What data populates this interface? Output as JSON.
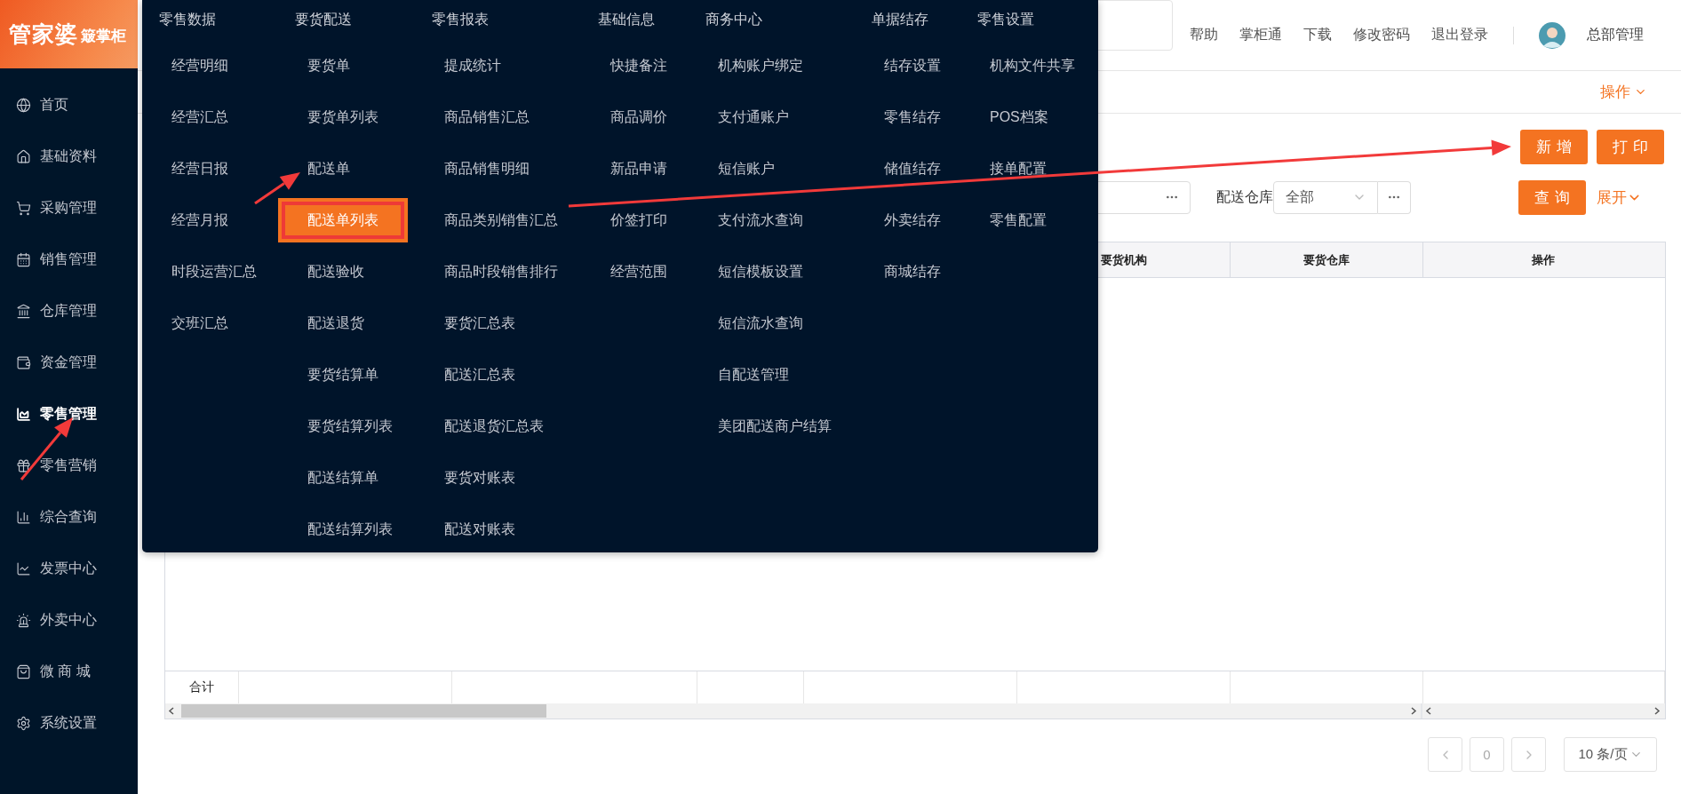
{
  "logo": {
    "brand": "管家婆",
    "product": "簸掌柜"
  },
  "sidebar": {
    "items": [
      {
        "label": "首页",
        "selected": false
      },
      {
        "label": "基础资料",
        "selected": false
      },
      {
        "label": "采购管理",
        "selected": false
      },
      {
        "label": "销售管理",
        "selected": false
      },
      {
        "label": "仓库管理",
        "selected": false
      },
      {
        "label": "资金管理",
        "selected": false
      },
      {
        "label": "零售管理",
        "selected": true
      },
      {
        "label": "零售营销",
        "selected": false
      },
      {
        "label": "综合查询",
        "selected": false
      },
      {
        "label": "发票中心",
        "selected": false
      },
      {
        "label": "外卖中心",
        "selected": false
      },
      {
        "label": "微 商 城",
        "selected": false
      },
      {
        "label": "系统设置",
        "selected": false
      }
    ]
  },
  "header": {
    "links": [
      "帮助",
      "掌柜通",
      "下载",
      "修改密码",
      "退出登录"
    ],
    "user": "总部管理"
  },
  "tab_bar": {
    "action": "操作"
  },
  "menu": {
    "columns": [
      {
        "title": "零售数据",
        "items": [
          {
            "label": "经营明细",
            "selected": false
          },
          {
            "label": "经营汇总",
            "selected": false
          },
          {
            "label": "经营日报",
            "selected": false
          },
          {
            "label": "经营月报",
            "selected": false
          },
          {
            "label": "时段运营汇总",
            "selected": false
          },
          {
            "label": "交班汇总",
            "selected": false
          }
        ]
      },
      {
        "title": "要货配送",
        "items": [
          {
            "label": "要货单",
            "selected": false
          },
          {
            "label": "要货单列表",
            "selected": false
          },
          {
            "label": "配送单",
            "selected": false
          },
          {
            "label": "配送单列表",
            "selected": true
          },
          {
            "label": "配送验收",
            "selected": false
          },
          {
            "label": "配送退货",
            "selected": false
          },
          {
            "label": "要货结算单",
            "selected": false
          },
          {
            "label": "要货结算列表",
            "selected": false
          },
          {
            "label": "配送结算单",
            "selected": false
          },
          {
            "label": "配送结算列表",
            "selected": false
          }
        ]
      },
      {
        "title": "零售报表",
        "items": [
          {
            "label": "提成统计",
            "selected": false
          },
          {
            "label": "商品销售汇总",
            "selected": false
          },
          {
            "label": "商品销售明细",
            "selected": false
          },
          {
            "label": "商品类别销售汇总",
            "selected": false
          },
          {
            "label": "商品时段销售排行",
            "selected": false
          },
          {
            "label": "要货汇总表",
            "selected": false
          },
          {
            "label": "配送汇总表",
            "selected": false
          },
          {
            "label": "配送退货汇总表",
            "selected": false
          },
          {
            "label": "要货对账表",
            "selected": false
          },
          {
            "label": "配送对账表",
            "selected": false
          }
        ]
      },
      {
        "title": "基础信息",
        "items": [
          {
            "label": "快捷备注",
            "selected": false
          },
          {
            "label": "商品调价",
            "selected": false
          },
          {
            "label": "新品申请",
            "selected": false
          },
          {
            "label": "价签打印",
            "selected": false
          },
          {
            "label": "经营范围",
            "selected": false
          }
        ]
      },
      {
        "title": "商务中心",
        "items": [
          {
            "label": "机构账户绑定",
            "selected": false
          },
          {
            "label": "支付通账户",
            "selected": false
          },
          {
            "label": "短信账户",
            "selected": false
          },
          {
            "label": "支付流水查询",
            "selected": false
          },
          {
            "label": "短信模板设置",
            "selected": false
          },
          {
            "label": "短信流水查询",
            "selected": false
          },
          {
            "label": "自配送管理",
            "selected": false
          },
          {
            "label": "美团配送商户结算",
            "selected": false
          }
        ]
      },
      {
        "title": "单据结存",
        "items": [
          {
            "label": "结存设置",
            "selected": false
          },
          {
            "label": "零售结存",
            "selected": false
          },
          {
            "label": "储值结存",
            "selected": false
          },
          {
            "label": "外卖结存",
            "selected": false
          },
          {
            "label": "商城结存",
            "selected": false
          }
        ]
      },
      {
        "title": "零售设置",
        "items": [
          {
            "label": "机构文件共享",
            "selected": false
          },
          {
            "label": "POS档案",
            "selected": false
          },
          {
            "label": "接单配置",
            "selected": false
          },
          {
            "label": "零售配置",
            "selected": false
          }
        ]
      }
    ]
  },
  "toolbar": {
    "buttons": [
      "新增",
      "打印"
    ]
  },
  "filters": {
    "warehouse_label": "配送仓库",
    "warehouse_value": "全部",
    "query_button": "查询",
    "expand_link": "展开"
  },
  "table": {
    "columns": [
      "要货机构",
      "要货仓库",
      "操作"
    ],
    "footer_label": "合计"
  },
  "pagination": {
    "page": "0",
    "page_size": "10 条/页"
  }
}
